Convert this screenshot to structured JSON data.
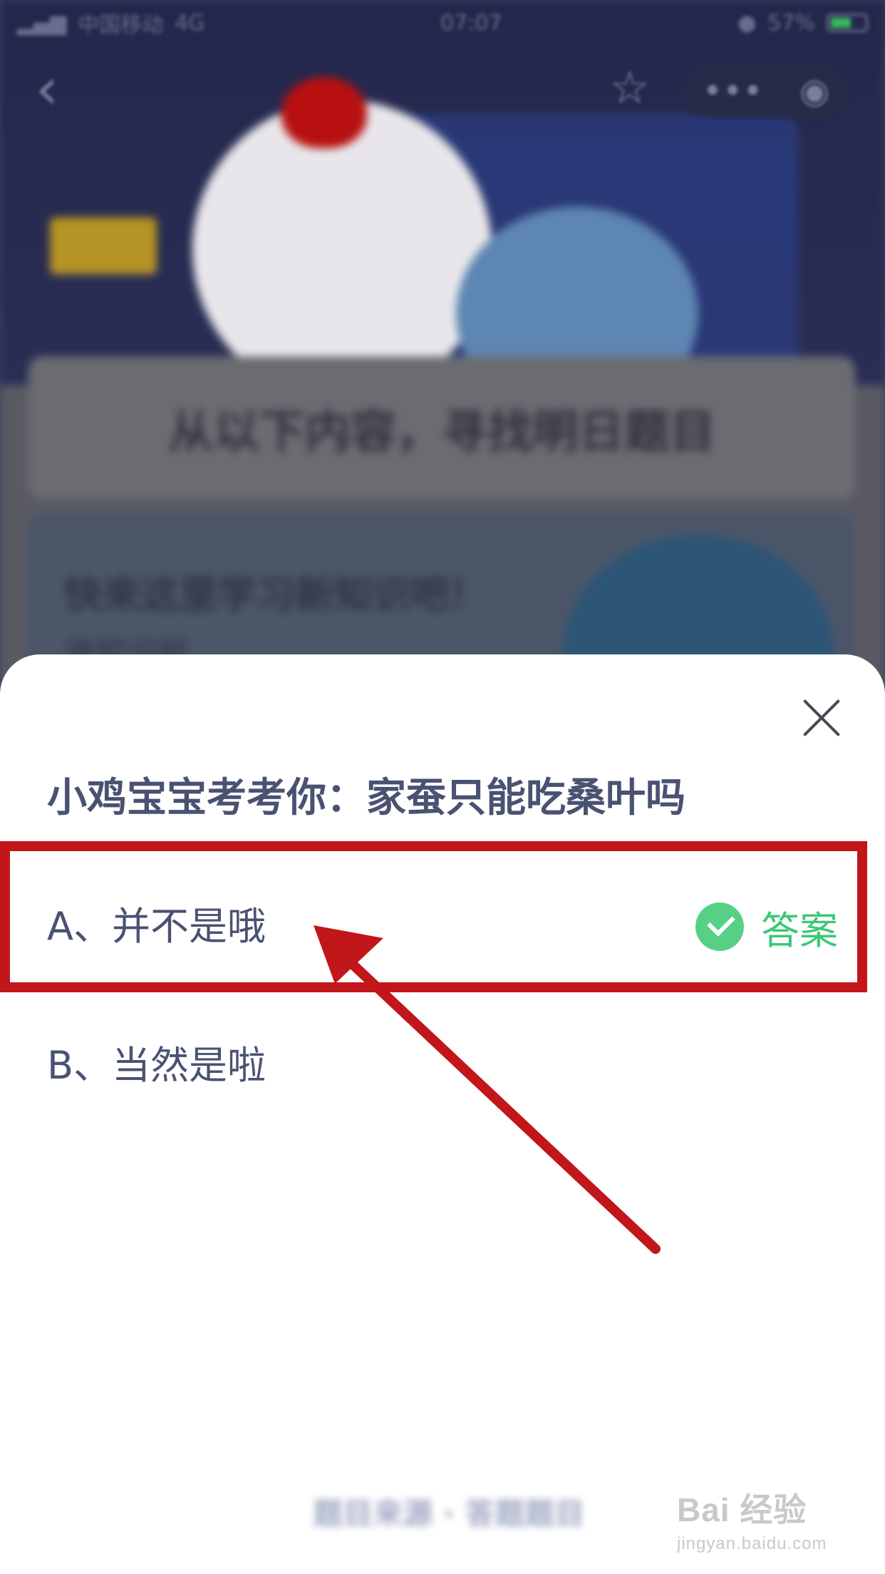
{
  "status_bar": {
    "carrier": "中国移动",
    "network": "4G",
    "time": "07:07",
    "battery": "57%"
  },
  "background": {
    "heading": "从以下内容，寻找明日题目",
    "card_title": "快来这里学习新知识吧！",
    "card_subtitle": "涨知识啦"
  },
  "modal": {
    "question": "小鸡宝宝考考你：家蚕只能吃桑叶吗",
    "options": [
      {
        "label": "A、并不是哦",
        "is_answer": true,
        "answer_label": "答案"
      },
      {
        "label": "B、当然是啦",
        "is_answer": false
      }
    ],
    "footer_blurred": "题目来源 · 答题题目"
  },
  "icons": {
    "back": "back-chevron-icon",
    "favorite": "star-icon",
    "more": "more-dots-icon",
    "target": "target-icon",
    "close": "close-icon",
    "check": "check-circle-icon"
  },
  "colors": {
    "answer_green": "#57d086",
    "highlight_red": "#c1161a",
    "text_primary": "#4a5272"
  },
  "watermark": {
    "brand": "Bai 经验",
    "url": "jingyan.baidu.com"
  }
}
